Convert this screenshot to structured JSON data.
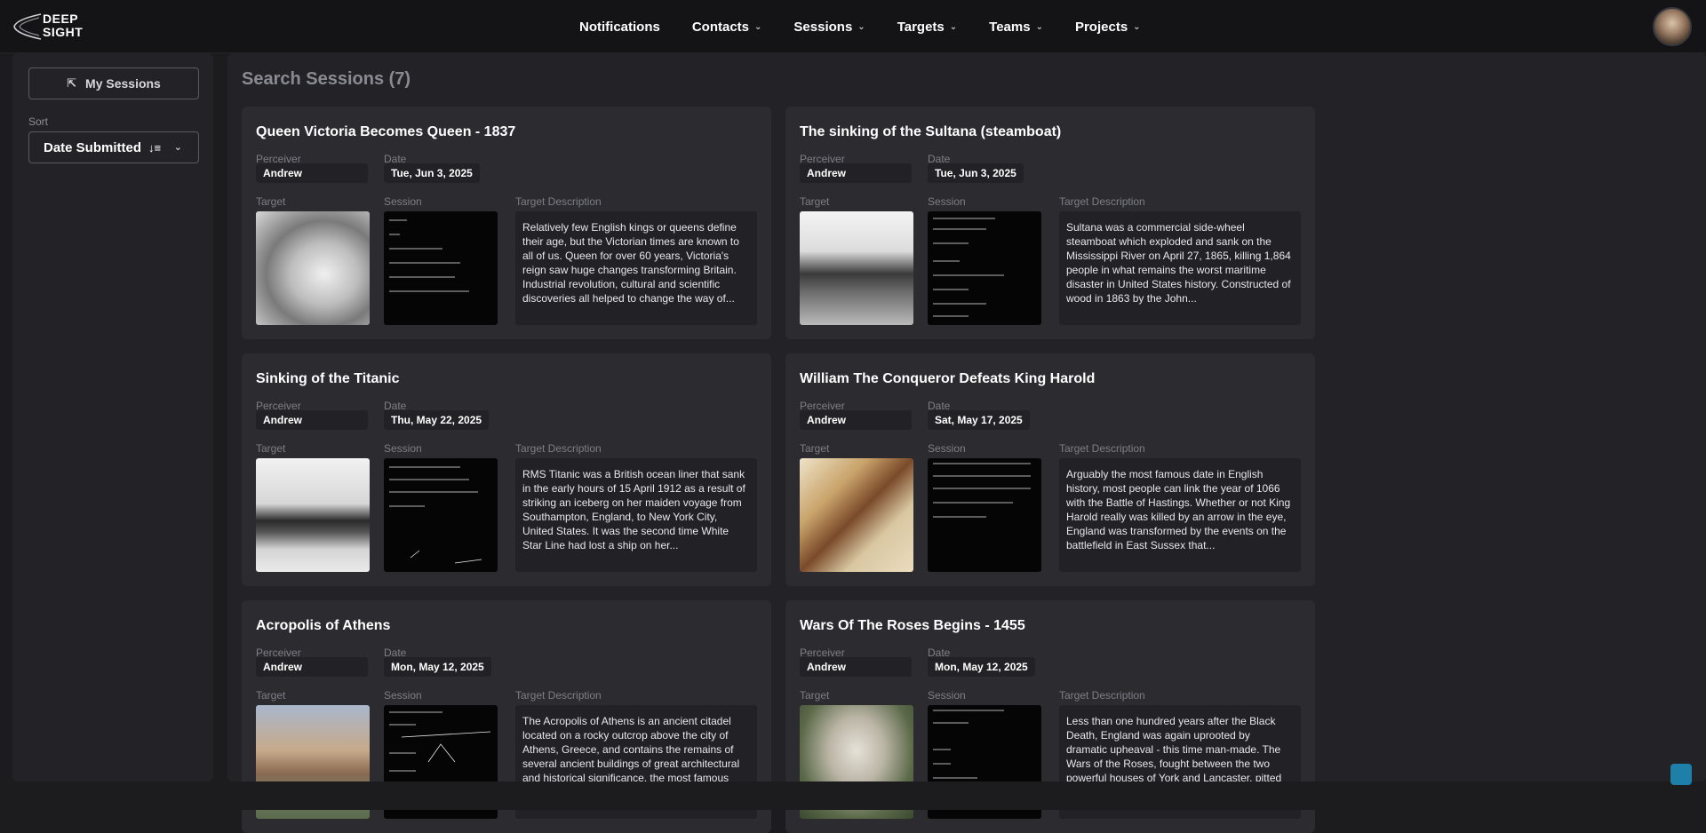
{
  "brand": {
    "line1": "DEEP",
    "line2": "SIGHT",
    "icon": "arc-logo-icon"
  },
  "nav": {
    "items": [
      {
        "label": "Notifications",
        "has_dropdown": false
      },
      {
        "label": "Contacts",
        "has_dropdown": true
      },
      {
        "label": "Sessions",
        "has_dropdown": true
      },
      {
        "label": "Targets",
        "has_dropdown": true
      },
      {
        "label": "Teams",
        "has_dropdown": true
      },
      {
        "label": "Projects",
        "has_dropdown": true
      }
    ],
    "chevron_icon": "chevron-down-icon"
  },
  "sidebar": {
    "my_sessions_label": "My Sessions",
    "my_sessions_icon": "arrow-up-left-icon",
    "sort_label": "Sort",
    "sort_value": "Date Submitted",
    "sort_icon": "sort-descending-icon"
  },
  "main": {
    "title": "Search Sessions (7)",
    "field_labels": {
      "perceiver": "Perceiver",
      "date": "Date",
      "target": "Target",
      "session": "Session",
      "target_description": "Target Description"
    },
    "sessions": [
      {
        "title": "Queen Victoria Becomes Queen - 1837",
        "perceiver": "Andrew",
        "date": "Tue, Jun 3, 2025",
        "target_image": "portrait-photo",
        "description": "Relatively few English kings or queens define their age, but the Victorian times are known to all of us. Queen for over 60 years, Victoria's reign saw huge changes transforming Britain. Industrial revolution, cultural and scientific discoveries all helped to change the way of..."
      },
      {
        "title": "The sinking of the Sultana (steamboat)",
        "perceiver": "Andrew",
        "date": "Tue, Jun 3, 2025",
        "target_image": "steamboat-photo",
        "description": "Sultana was a commercial side-wheel steamboat which exploded and sank on the Mississippi River on April 27, 1865, killing 1,864 people in what remains the worst maritime disaster in United States history. Constructed of wood in 1863 by the John..."
      },
      {
        "title": "Sinking of the Titanic",
        "perceiver": "Andrew",
        "date": "Thu, May 22, 2025",
        "target_image": "ship-photo",
        "description": "RMS Titanic was a British ocean liner that sank in the early hours of 15 April 1912 as a result of striking an iceberg on her maiden voyage from Southampton, England, to New York City, United States. It was the second time White Star Line had lost a ship on her..."
      },
      {
        "title": "William The Conqueror Defeats King Harold",
        "perceiver": "Andrew",
        "date": "Sat, May 17, 2025",
        "target_image": "tapestry-image",
        "description": "Arguably the most famous date in English history, most people can link the year of 1066 with the Battle of Hastings. Whether or not King Harold really was killed by an arrow in the eye, England was transformed by the events on the battlefield in East Sussex that..."
      },
      {
        "title": "Acropolis of Athens",
        "perceiver": "Andrew",
        "date": "Mon, May 12, 2025",
        "target_image": "acropolis-photo",
        "description": "The Acropolis of Athens is an ancient citadel located on a rocky outcrop above the city of Athens, Greece, and contains the remains of several ancient buildings of great architectural and historical significance, the most famous being the Parthenon. The wor..."
      },
      {
        "title": "Wars Of The Roses Begins - 1455",
        "perceiver": "Andrew",
        "date": "Mon, May 12, 2025",
        "target_image": "statue-photo",
        "description": "Less than one hundred years after the Black Death, England was again uprooted by dramatic upheaval - this time man-made. The Wars of the Roses, fought between the two powerful houses of York and Lancaster, pitted families against each other. After the remov..."
      }
    ]
  },
  "colors": {
    "accent": "#1e7fa8",
    "background": "#1c1c1f",
    "card": "#2b2b30"
  }
}
